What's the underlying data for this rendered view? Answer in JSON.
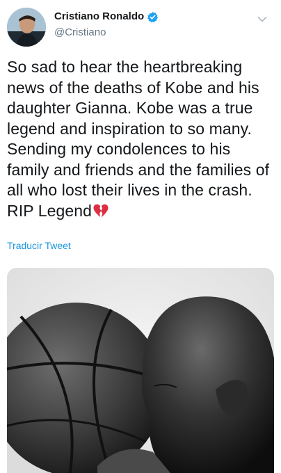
{
  "tweet": {
    "display_name": "Cristiano Ronaldo",
    "handle": "@Cristiano",
    "text": "So sad to hear the heartbreaking news of the deaths of Kobe and his daughter Gianna. Kobe was a true legend and inspiration to so many. Sending my condolences to his family and friends and the families of all who lost their lives in the crash. RIP Legend",
    "translate_label": "Traducir Tweet"
  },
  "icons": {
    "verified": "verified-badge-icon",
    "caret": "chevron-down-icon",
    "heart": "broken-heart-emoji"
  },
  "colors": {
    "accent": "#1b95e0",
    "verified": "#1da1f2",
    "secondary_text": "#657786",
    "heart": "#dd2e44"
  }
}
